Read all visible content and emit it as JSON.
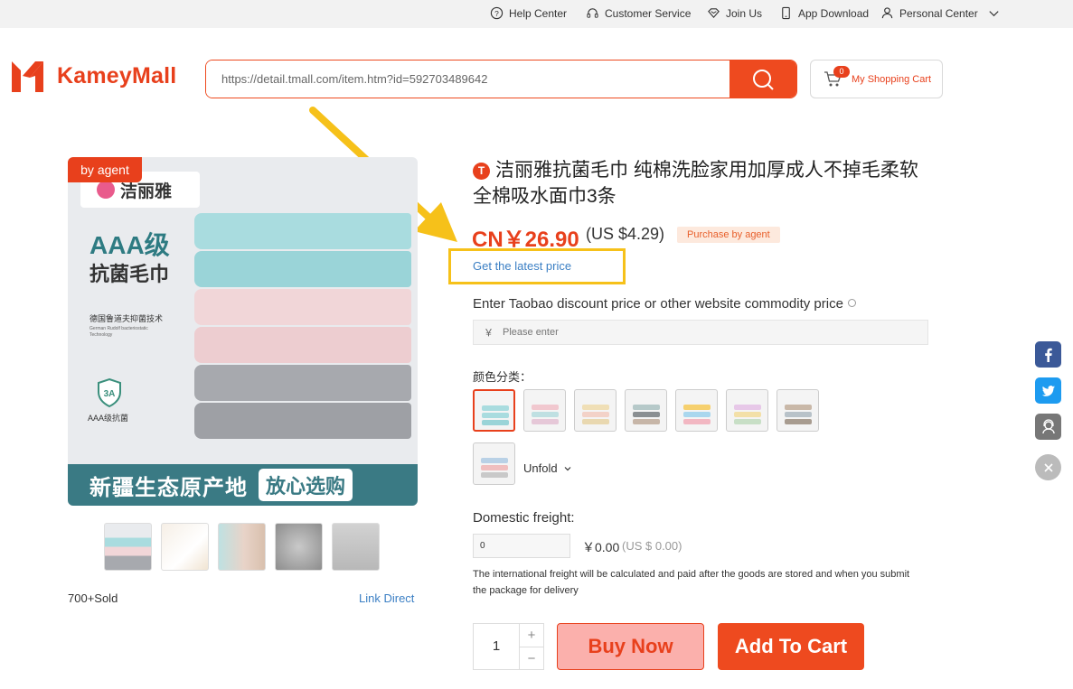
{
  "topbar": {
    "help_center": "Help Center",
    "customer_service": "Customer Service",
    "join_us": "Join Us",
    "app_download": "App Download",
    "personal_center": "Personal Center"
  },
  "header": {
    "logo_text": "KameyMall",
    "search_value": "https://detail.tmall.com/item.htm?id=592703489642",
    "cart_count": "0",
    "cart_label": "My Shopping Cart"
  },
  "gallery": {
    "agent_tag": "by agent",
    "brand": "洁丽雅",
    "aaa": "AAA级",
    "aaa_sub": "抗菌毛巾",
    "tech": "德国鲁道夫抑菌技术",
    "tech_en": "German Rudolf bacteriostatic Technology",
    "shield_label": "AAA级抗菌",
    "shield_text": "3A",
    "banner_left": "新疆生态原产地",
    "banner_right": "放心选购",
    "sold": "700+Sold",
    "link_direct": "Link Direct"
  },
  "product": {
    "shop_icon": "T",
    "title": "洁丽雅抗菌毛巾 纯棉洗脸家用加厚成人不掉毛柔软全棉吸水面巾3条",
    "price_cn": "CN￥26.90",
    "price_us": "(US $4.29)",
    "agent_badge": "Purchase by agent",
    "latest_price": "Get the latest price",
    "discount_label": "Enter Taobao discount price or other website commodity price",
    "discount_currency": "￥",
    "discount_placeholder": "Please enter",
    "color_label": "颜色分类：",
    "unfold": "Unfold",
    "freight_label": "Domestic freight:",
    "freight_value": "0",
    "freight_cny": "￥0.00",
    "freight_usd": "(US $ 0.00)",
    "freight_note": "The international freight will be calculated and paid after the goods are stored and when you submit the package for delivery",
    "quantity": "1",
    "plus": "+",
    "minus": "−",
    "buy_now": "Buy Now",
    "add_to_cart": "Add To Cart"
  },
  "colors": {
    "accent": "#ee4a1f",
    "link": "#3b7fc4",
    "highlight": "#f6c11a"
  }
}
